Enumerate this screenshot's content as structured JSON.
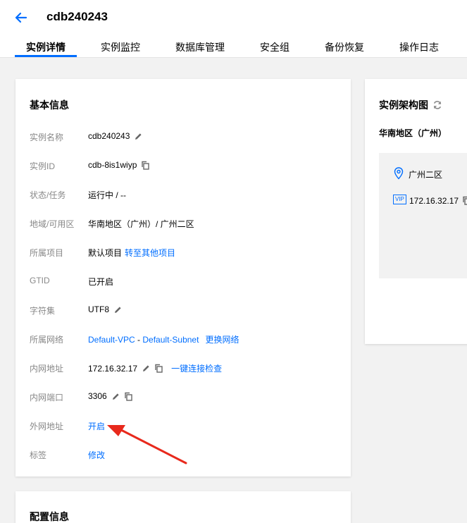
{
  "header": {
    "title": "cdb240243",
    "tabs": [
      {
        "label": "实例详情"
      },
      {
        "label": "实例监控"
      },
      {
        "label": "数据库管理"
      },
      {
        "label": "安全组"
      },
      {
        "label": "备份恢复"
      },
      {
        "label": "操作日志"
      }
    ]
  },
  "basic_info": {
    "title": "基本信息",
    "rows": [
      {
        "label": "实例名称",
        "value": "cdb240243"
      },
      {
        "label": "实例ID",
        "value": "cdb-8is1wiyp"
      },
      {
        "label": "状态/任务",
        "value": "运行中 / --"
      },
      {
        "label": "地域/可用区",
        "value": "华南地区（广州）/ 广州二区"
      },
      {
        "label": "所属项目",
        "value": "默认项目",
        "link": "转至其他项目"
      },
      {
        "label": "GTID",
        "value": "已开启"
      },
      {
        "label": "字符集",
        "value": "UTF8"
      },
      {
        "label": "所属网络",
        "vpc": "Default-VPC",
        "sep": " - ",
        "subnet": "Default-Subnet",
        "link": "更换网络"
      },
      {
        "label": "内网地址",
        "value": "172.16.32.17",
        "link": "一键连接检查"
      },
      {
        "label": "内网端口",
        "value": "3306"
      },
      {
        "label": "外网地址",
        "link": "开启"
      },
      {
        "label": "标签",
        "link": "修改"
      }
    ]
  },
  "arch": {
    "title": "实例架构图",
    "region": "华南地区（广州）",
    "zone": "广州二区",
    "vip_badge": "VIP",
    "vip": "172.16.32.17"
  },
  "config": {
    "title": "配置信息"
  },
  "colors": {
    "accent": "#006eff",
    "annotation_arrow": "#e8291c"
  }
}
